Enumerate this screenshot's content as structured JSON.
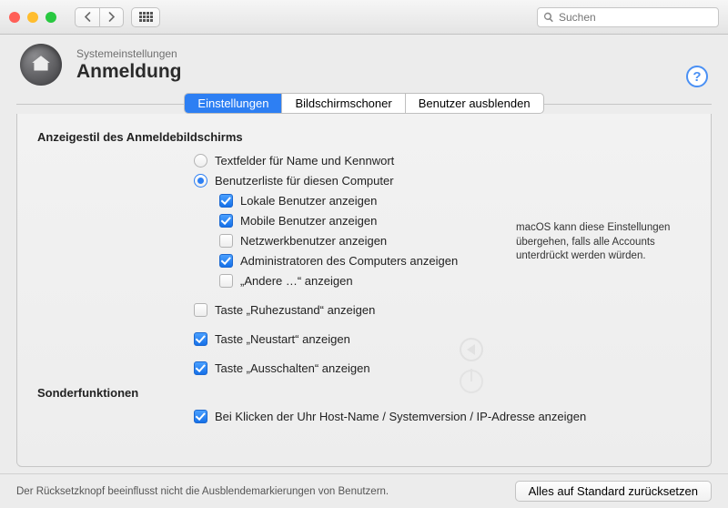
{
  "search": {
    "placeholder": "Suchen"
  },
  "header": {
    "breadcrumb": "Systemeinstellungen",
    "title": "Anmeldung"
  },
  "tabs": [
    "Einstellungen",
    "Bildschirmschoner",
    "Benutzer ausblenden"
  ],
  "activeTab": 0,
  "sections": {
    "style": {
      "title": "Anzeigestil des Anmeldebildschirms",
      "radios": {
        "textfields": {
          "label": "Textfelder für Name und Kennwort",
          "checked": false
        },
        "userlist": {
          "label": "Benutzerliste für diesen Computer",
          "checked": true
        }
      },
      "userlistChecks": [
        {
          "label": "Lokale Benutzer anzeigen",
          "checked": true
        },
        {
          "label": "Mobile Benutzer anzeigen",
          "checked": true
        },
        {
          "label": "Netzwerkbenutzer anzeigen",
          "checked": false
        },
        {
          "label": "Administratoren des Computers anzeigen",
          "checked": true
        },
        {
          "label": "„Andere …“ anzeigen",
          "checked": false
        }
      ],
      "buttons": [
        {
          "label": "Taste „Ruhezustand“ anzeigen",
          "checked": false
        },
        {
          "label": "Taste „Neustart“ anzeigen",
          "checked": true
        },
        {
          "label": "Taste „Ausschalten“ anzeigen",
          "checked": true
        }
      ],
      "note": "macOS kann diese Einstellungen übergehen, falls alle Accounts unterdrückt werden würden."
    },
    "extra": {
      "title": "Sonderfunktionen",
      "checks": [
        {
          "label": "Bei Klicken der Uhr Host-Name / Systemversion / IP-Adresse anzeigen",
          "checked": true
        }
      ]
    }
  },
  "footer": {
    "hint": "Der Rücksetzknopf beeinflusst nicht die Ausblendemarkierungen von Benutzern.",
    "reset": "Alles auf Standard zurücksetzen"
  }
}
